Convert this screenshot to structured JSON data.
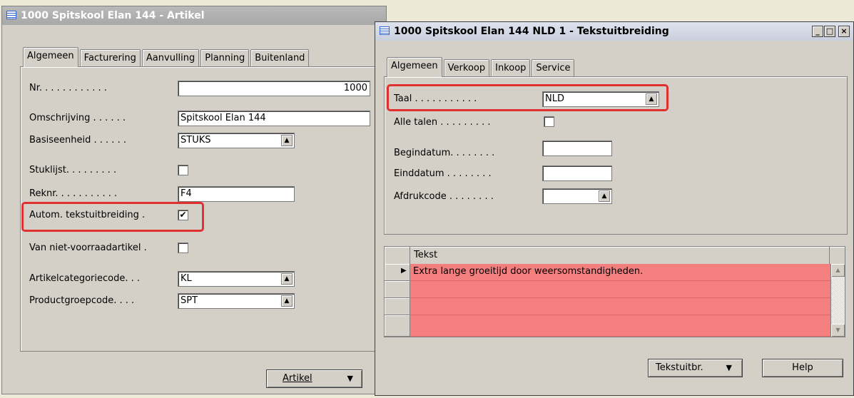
{
  "item_card": {
    "title": "1000 Spitskool Elan 144 - Artikel",
    "tabs": [
      "Algemeen",
      "Facturering",
      "Aanvulling",
      "Planning",
      "Buitenland"
    ],
    "fields": {
      "nr_label": "Nr. . . . . . . . . . . .",
      "nr_value": "1000",
      "omschrijving_label": "Omschrijving . . . . . .",
      "omschrijving_value": "Spitskool Elan 144",
      "basiseenheid_label": "Basiseenheid . . . . . .",
      "basiseenheid_value": "STUKS",
      "stuklijst_label": "Stuklijst. . . . . . . . .",
      "reknr_label": "Reknr. . . . . . . . . . .",
      "reknr_value": "F4",
      "autom_label": "Autom. tekstuitbreiding .",
      "autom_checked": "✔",
      "vanniet_label": "Van niet-voorraadartikel .",
      "artcat_label": "Artikelcategoriecode. . .",
      "artcat_value": "KL",
      "prodgroep_label": "Productgroepcode. . . .",
      "prodgroep_value": "SPT"
    },
    "artikel_button": "Artikel"
  },
  "text_ext": {
    "title": "1000 Spitskool Elan 144 NLD 1 - Tekstuitbreiding",
    "tabs": [
      "Algemeen",
      "Verkoop",
      "Inkoop",
      "Service"
    ],
    "fields": {
      "taal_label": "Taal . . . . . . . . . . .",
      "taal_value": "NLD",
      "alletalen_label": "Alle talen . . . . . . . . .",
      "begindatum_label": "Begindatum. . . . . . . .",
      "begindatum_value": "",
      "einddatum_label": "Einddatum . . . . . . . .",
      "einddatum_value": "",
      "afdrukcode_label": "Afdrukcode . . . . . . . .",
      "afdrukcode_value": ""
    },
    "grid": {
      "column_header": "Tekst",
      "rows": [
        "Extra lange groeitijd door weersomstandigheden.",
        "",
        "",
        ""
      ]
    },
    "buttons": {
      "tekstuitbr": "Tekstuitbr.",
      "help": "Help"
    },
    "window_buttons": {
      "minimize": "_",
      "maximize": "□",
      "close": "×"
    }
  },
  "colors": {
    "highlight_box": "#e03030",
    "grid_row_fill": "#f47f7f"
  },
  "icons": {
    "lookup": "up-arrow-lookup-icon",
    "dropdown": "dropdown-arrow-icon",
    "row_pointer": "row-pointer-icon"
  }
}
